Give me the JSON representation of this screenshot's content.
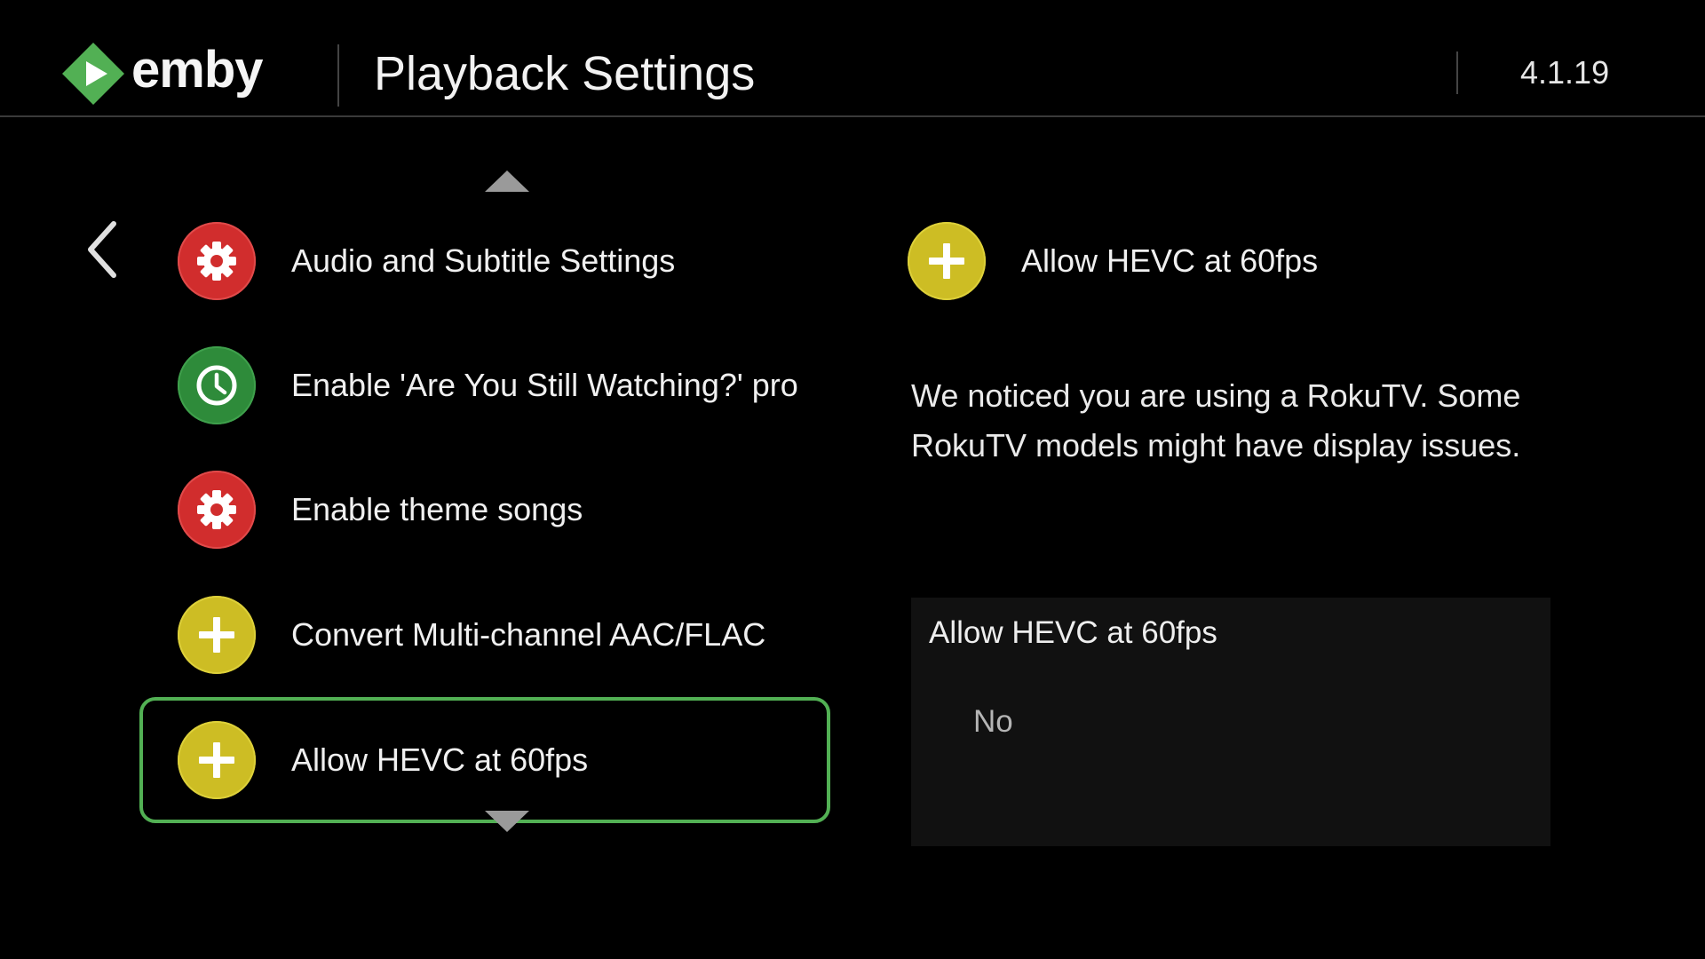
{
  "header": {
    "logo_text": "emby",
    "title": "Playback Settings",
    "version": "4.1.19"
  },
  "colors": {
    "accent_green": "#52b054",
    "icon_red": "#d12d2d",
    "icon_green": "#2e8b3a",
    "icon_yellow": "#cdbd24",
    "background": "#000000"
  },
  "menu": {
    "items": [
      {
        "label": "Audio and Subtitle Settings",
        "icon": "gear-icon",
        "color": "red"
      },
      {
        "label": "Enable 'Are You Still Watching?' prom",
        "icon": "clock-icon",
        "color": "green"
      },
      {
        "label": "Enable theme songs",
        "icon": "gear-icon",
        "color": "red"
      },
      {
        "label": "Convert Multi-channel AAC/FLAC",
        "icon": "plus-icon",
        "color": "yellow"
      },
      {
        "label": "Allow HEVC at 60fps",
        "icon": "plus-icon",
        "color": "yellow",
        "focused": true
      }
    ]
  },
  "detail": {
    "title": "Allow HEVC at 60fps",
    "icon": "plus-icon",
    "description": "We noticed you are using a RokuTV. Some RokuTV models might have display issues.",
    "setting_title": "Allow HEVC at 60fps",
    "setting_value": "No"
  }
}
